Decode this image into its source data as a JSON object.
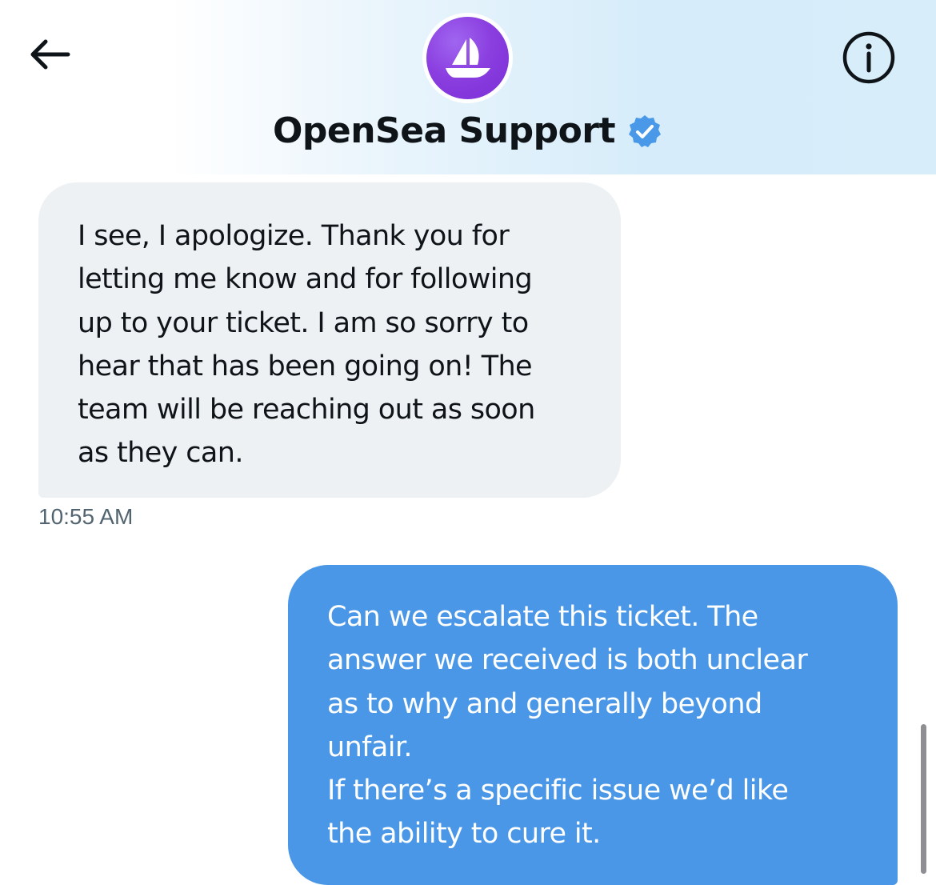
{
  "header": {
    "title": "OpenSea Support",
    "icons": {
      "back": "arrow-left-icon",
      "info": "info-icon",
      "verified": "verified-badge-icon",
      "avatar": "opensea-ship-logo"
    }
  },
  "messages": [
    {
      "direction": "incoming",
      "text": "I see, I apologize. Thank you for\nletting me know and for following\nup to your ticket. I am so sorry to\nhear that has been going on! The\nteam will be reaching out as soon\nas they can.",
      "time": "10:55 AM"
    },
    {
      "direction": "outgoing",
      "text": "Can we escalate this ticket. The\nanswer we received is both unclear\nas to why and generally beyond\nunfair.\nIf there’s a specific issue we’d like\nthe ability to cure it."
    }
  ],
  "colors": {
    "incoming_bubble": "#eef1f3",
    "outgoing_bubble": "#4a97e8",
    "verified": "#4a99e9",
    "avatar": "#8b3fe0",
    "timestamp": "#536471"
  }
}
